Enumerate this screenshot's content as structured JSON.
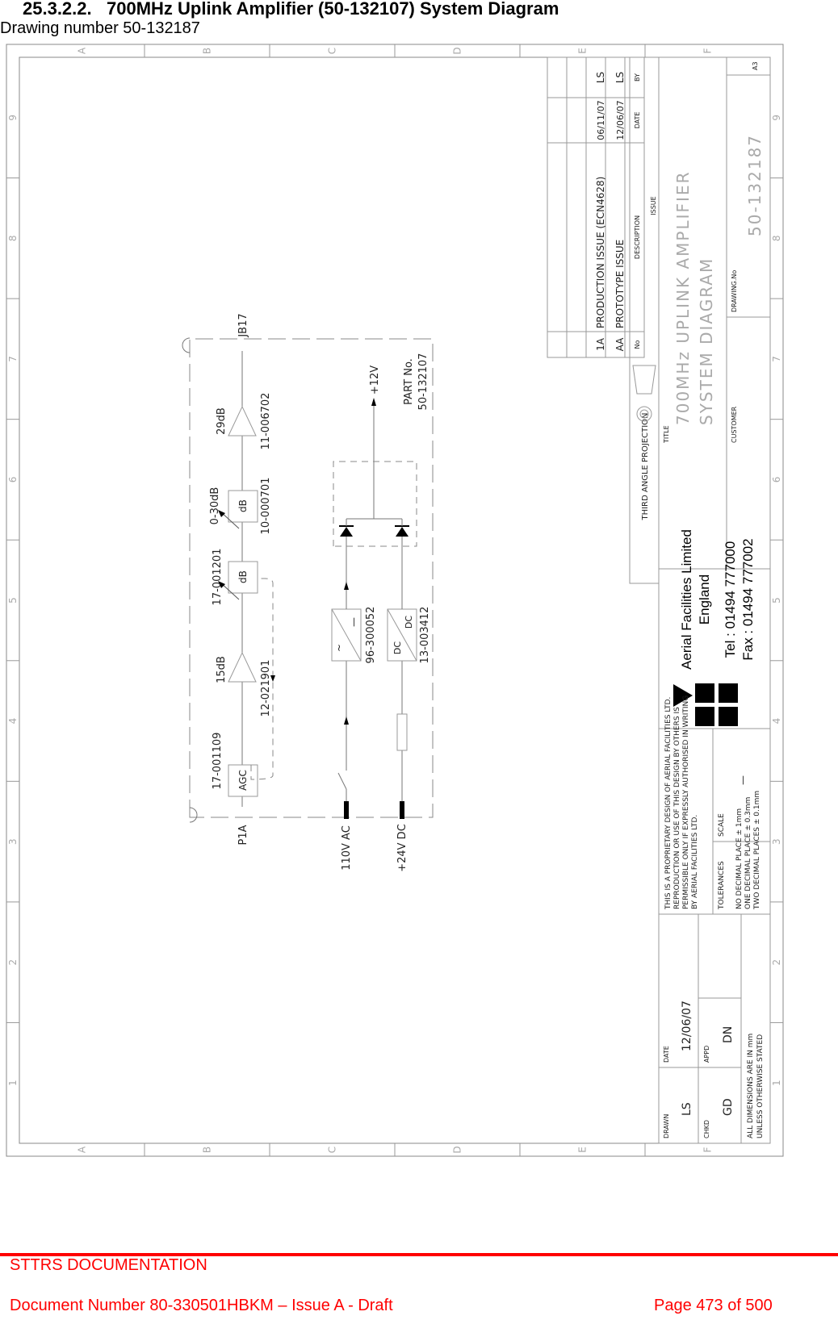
{
  "header": {
    "section_number": "25.3.2.2.",
    "section_title": "700MHz Uplink Amplifier (50-132107) System Diagram",
    "subtitle": "Drawing number 50-132187"
  },
  "drawing": {
    "border": {
      "column_labels": [
        "A",
        "B",
        "C",
        "D",
        "E",
        "F"
      ],
      "row_labels": [
        "1",
        "2",
        "3",
        "4",
        "5",
        "6",
        "7",
        "8",
        "9"
      ]
    },
    "schematic": {
      "input_connector": "P1A",
      "output_connector": "JB17",
      "part_label": "PART No.",
      "part_number": "50-132107",
      "rf_chain": [
        {
          "type": "agc",
          "label": "AGC",
          "part": "17-001109"
        },
        {
          "type": "amplifier",
          "gain": "15dB",
          "part": "12-021901"
        },
        {
          "type": "attenuator",
          "label": "dB",
          "part": "17-001201"
        },
        {
          "type": "attenuator",
          "label": "dB",
          "range": "0-30dB",
          "part": "10-000701"
        },
        {
          "type": "amplifier",
          "gain": "29dB",
          "part": "11-006702"
        }
      ],
      "power": {
        "ac_input": "110V AC",
        "dc_input": "+24V DC",
        "psu_part": "96-300052",
        "dcdc_label_in": "DC",
        "dcdc_label_out": "DC",
        "dcdc_part": "13-003412",
        "output": "+12V"
      }
    },
    "revisions": {
      "headers": {
        "no": "No",
        "description": "DESCRIPTION",
        "date": "DATE",
        "by": "BY"
      },
      "section_label": "ISSUE",
      "rows": [
        {
          "no": "1A",
          "description": "PRODUCTION ISSUE (ECN4628)",
          "date": "06/11/07",
          "by": "LS"
        },
        {
          "no": "AA",
          "description": "PROTOTYPE ISSUE",
          "date": "12/06/07",
          "by": "LS"
        }
      ]
    },
    "title_block": {
      "projection": "THIRD ANGLE PROJECTION",
      "title_label": "TITLE",
      "title_line1": "700MHz UPLINK AMPLIFIER",
      "title_line2": "SYSTEM DIAGRAM",
      "customer_label": "CUSTOMER",
      "drawing_no_label": "DRAWING.No",
      "drawing_no": "50-132187",
      "sheet_size": "A3",
      "company": {
        "name": "Aerial Facilities Limited",
        "country": "England",
        "tel": "Tel : 01494 777000",
        "fax": "Fax : 01494 777002"
      },
      "proprietary_notice": [
        "THIS IS A PROPRIETARY DESIGN OF AERIAL FACILITIES LTD.",
        "REPRODUCTION OR USE OF THIS DESIGN BY OTHERS IS",
        "PERMISSIBLE ONLY IF EXPRESSLY AUTHORISED IN WRITING",
        "BY AERIAL FACILITIES LTD."
      ],
      "tolerances_label": "TOLERANCES",
      "tolerances": [
        "NO DECIMAL PLACE ± 1mm",
        "ONE DECIMAL PLACE ± 0.3mm",
        "TWO DECIMAL PLACES ± 0.1mm"
      ],
      "scale_label": "SCALE",
      "scale_value": "—",
      "drawn_label": "DRAWN",
      "drawn_value": "LS",
      "date_label": "DATE",
      "date_value": "12/06/07",
      "chkd_label": "CHKD",
      "chkd_value": "GD",
      "appd_label": "APPD",
      "appd_value": "DN",
      "dimensions_note": [
        "ALL DIMENSIONS ARE IN mm",
        "UNLESS OTHERWISE STATED"
      ]
    }
  },
  "footer": {
    "title": "STTRS DOCUMENTATION",
    "document_number": "Document Number 80-330501HBKM – Issue A - Draft",
    "page": "Page 473 of 500"
  }
}
